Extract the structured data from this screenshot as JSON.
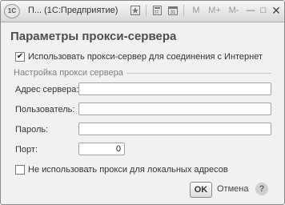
{
  "window": {
    "app_logo_text": "1С",
    "title": "П...  (1С:Предприятие)",
    "toolbar_icons": [
      "favorite-icon",
      "calculator-icon",
      "calendar-icon"
    ],
    "memory_buttons": [
      "M",
      "M+",
      "M-"
    ],
    "minimize_label": "—",
    "restore_label": "□",
    "close_label": "✕"
  },
  "form": {
    "title": "Параметры прокси-сервера",
    "use_proxy": {
      "label": "Использовать прокси-сервер для соединения с Интернет",
      "checked": true
    },
    "section_title": "Настройка прокси сервера",
    "fields": {
      "server": {
        "label": "Адрес сервера:",
        "value": ""
      },
      "user": {
        "label": "Пользователь:",
        "value": ""
      },
      "password": {
        "label": "Пароль:",
        "value": ""
      },
      "port": {
        "label": "Порт:",
        "value": "0"
      }
    },
    "bypass_local": {
      "label": "Не использовать прокси для локальных адресов",
      "checked": false
    }
  },
  "buttons": {
    "ok": "OK",
    "cancel": "Отмена",
    "help": "?"
  }
}
